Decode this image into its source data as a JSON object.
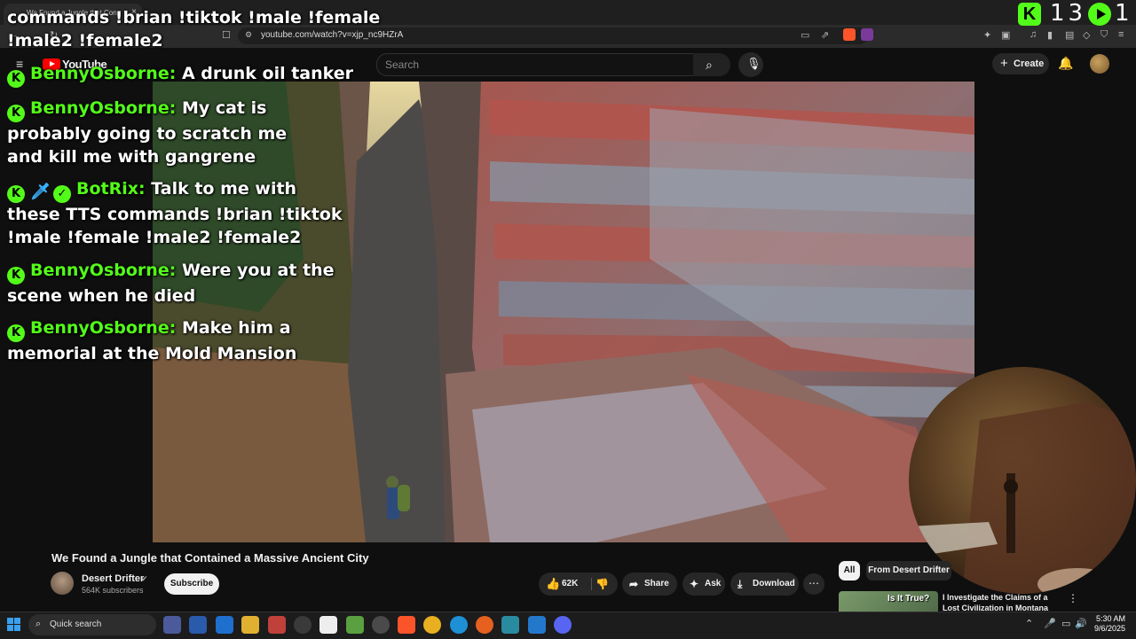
{
  "browser": {
    "tab_title": "We Found a Jungle that Con",
    "tab_close": "×",
    "url": "youtube.com/watch?v=xjp_nc9HZrA"
  },
  "youtube": {
    "logo_text": "YouTube",
    "search_placeholder": "Search",
    "create_label": "Create",
    "brand_color": "#ff0000"
  },
  "chat": {
    "accent_color": "#53fc18",
    "messages": [
      {
        "user": "",
        "text": "commands !brian !tiktok !male !female"
      },
      {
        "user": "",
        "text": "!male2 !female2"
      },
      {
        "user": "BennyOsborne:",
        "text": "A drunk oil tanker"
      },
      {
        "user": "BennyOsborne:",
        "text": "My cat is probably going to scratch me and kill me with gangrene"
      },
      {
        "user": "BotRix:",
        "text": "Talk to me with these TTS commands !brian !tiktok !male !female !male2 !female2"
      },
      {
        "user": "BennyOsborne:",
        "text": "Were you at the scene when he died"
      },
      {
        "user": "BennyOsborne:",
        "text": "Make him a memorial at the Mold Mansion"
      }
    ]
  },
  "kick_overlay": {
    "k": "K",
    "count": "13",
    "viewers": "1"
  },
  "video": {
    "title": "We Found a Jungle that Contained a Massive Ancient City",
    "channel": "Desert Drifter",
    "subscribers": "564K subscribers",
    "subscribe_label": "Subscribe",
    "likes": "62K",
    "share_label": "Share",
    "ask_label": "Ask",
    "download_label": "Download",
    "more_label": "⋯"
  },
  "recommendations": {
    "chips": [
      "All",
      "From Desert Drifter"
    ],
    "first": {
      "thumb_text": "Is It True?",
      "title": "I Investigate the Claims of a Lost Civilization in Montana"
    }
  },
  "taskbar": {
    "search_label": "Quick search",
    "time": "5:30 AM",
    "date": "9/6/2025"
  }
}
